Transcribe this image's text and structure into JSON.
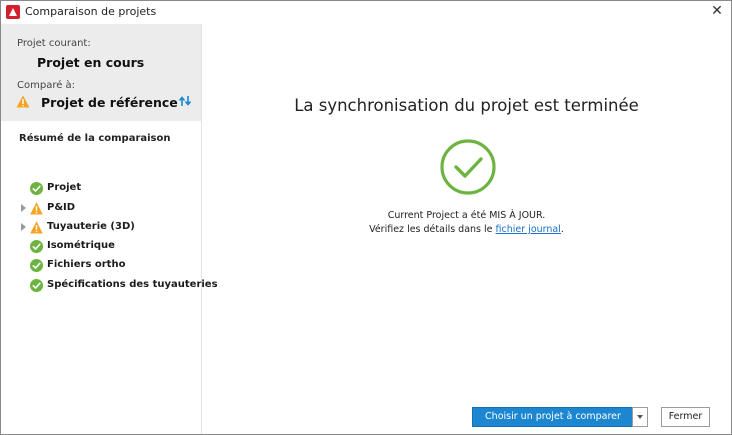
{
  "window": {
    "title": "Comparaison de projets",
    "close_glyph": "✕"
  },
  "sidebar": {
    "current_label": "Projet courant:",
    "current_value": "Projet en cours",
    "compared_label": "Comparé à:",
    "compared_value": "Projet de référence",
    "summary_title": "Résumé de la comparaison",
    "items": [
      {
        "label": "Projet",
        "status": "ok",
        "expandable": false
      },
      {
        "label": "P&ID",
        "status": "warning",
        "expandable": true
      },
      {
        "label": "Tuyauterie (3D)",
        "status": "warning",
        "expandable": true
      },
      {
        "label": "Isométrique",
        "status": "ok",
        "expandable": false
      },
      {
        "label": "Fichiers ortho",
        "status": "ok",
        "expandable": false
      },
      {
        "label": "Spécifications des tuyauteries",
        "status": "ok",
        "expandable": false
      }
    ]
  },
  "main": {
    "title": "La synchronisation du projet est terminée",
    "message_line1": "Current Project a été MIS À JOUR.",
    "message_line2_prefix": "Vérifiez les détails dans le ",
    "message_link": "fichier journal",
    "message_line2_suffix": "."
  },
  "footer": {
    "primary_button": "Choisir un projet à comparer",
    "close_button": "Fermer"
  },
  "colors": {
    "ok_green": "#6cb33f",
    "warning_orange": "#f4a425",
    "accent_blue": "#1c87d0",
    "link_blue": "#1a6fc8"
  }
}
